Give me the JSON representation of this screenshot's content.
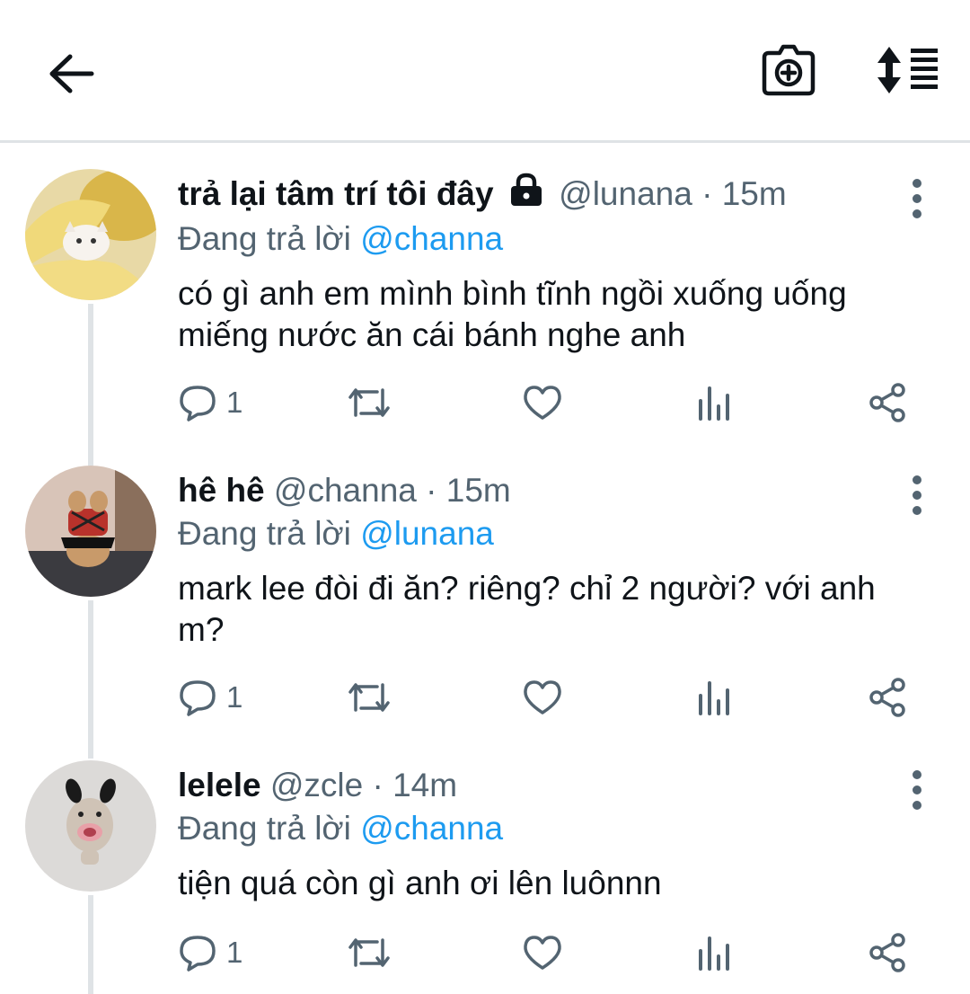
{
  "topbar": {
    "back_icon": "arrow-left-icon",
    "camera_icon": "camera-add-icon",
    "sort_icon": "sort-list-icon"
  },
  "tweets": [
    {
      "display_name": "trả lại tâm trí tôi đây",
      "locked": true,
      "handle": "@lunana",
      "separator": "·",
      "time": "15m",
      "reply_prefix": "Đang trả lời",
      "reply_to": "@channa",
      "text": "có gì anh em mình bình tĩnh ngồi xuống uống miếng nước ăn cái bánh nghe anh",
      "reply_count": "1"
    },
    {
      "display_name": "hê hê",
      "locked": false,
      "handle": "@channa",
      "separator": "·",
      "time": "15m",
      "reply_prefix": "Đang trả lời",
      "reply_to": "@lunana",
      "text": "mark lee đòi đi ăn? riêng? chỉ 2 người? với anh m?",
      "reply_count": "1"
    },
    {
      "display_name": "lelele",
      "locked": false,
      "handle": "@zcle",
      "separator": "·",
      "time": "14m",
      "reply_prefix": "Đang trả lời",
      "reply_to": "@channa",
      "text": "tiện quá còn gì anh ơi lên luônnn",
      "reply_count": "1"
    }
  ],
  "colors": {
    "text": "#0f1419",
    "secondary": "#536471",
    "mention": "#1d9bf0",
    "divider": "#dfe3e6"
  }
}
